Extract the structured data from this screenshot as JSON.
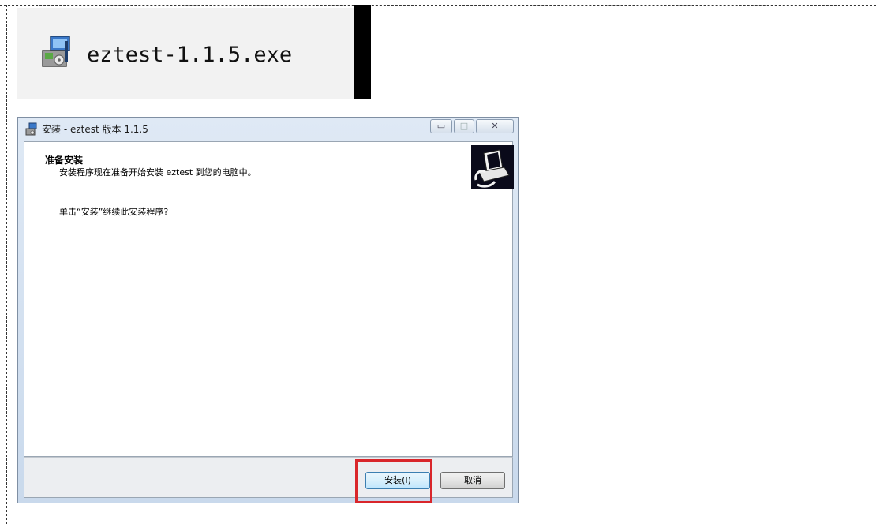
{
  "file": {
    "name": "eztest-1.1.5.exe",
    "icon": "installer-icon"
  },
  "window": {
    "title": "安装 - eztest 版本 1.1.5",
    "controls": {
      "minimize": "▭",
      "maximize": "□",
      "close": "✕"
    },
    "heading": "准备安装",
    "subtext": "安装程序现在准备开始安装 eztest 到您的电脑中。",
    "body": "单击“安装”继续此安装程序?",
    "buttons": {
      "install": "安装(I)",
      "cancel": "取消"
    }
  },
  "colors": {
    "highlight": "#d9262b",
    "window_frame": "#c9d9ec",
    "header_graphic_bg": "#0a0a1a"
  }
}
